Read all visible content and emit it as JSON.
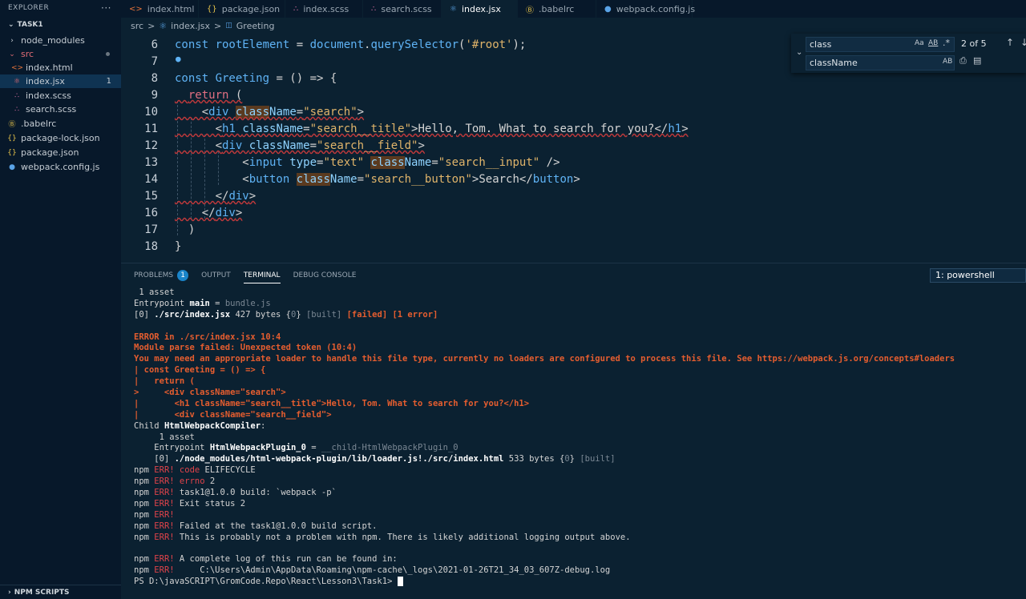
{
  "explorer": {
    "title": "EXPLORER",
    "more": "···",
    "project": "TASK1",
    "items": [
      {
        "label": "node_modules",
        "icon": "›",
        "color": "#c5ccd3"
      },
      {
        "label": "src",
        "icon": "⌄",
        "color": "#e06b74"
      },
      {
        "label": "index.html",
        "icon": "<>",
        "color": "#e7743a"
      },
      {
        "label": "index.jsx",
        "icon": "⚛",
        "color": "#e06b74",
        "badge": "1"
      },
      {
        "label": "index.scss",
        "icon": "∴",
        "color": "#d96fa3"
      },
      {
        "label": "search.scss",
        "icon": "∴",
        "color": "#d96fa3"
      },
      {
        "label": ".babelrc",
        "icon": "Ⓑ",
        "color": "#e6c34a"
      },
      {
        "label": "package-lock.json",
        "icon": "{}",
        "color": "#e6c34a"
      },
      {
        "label": "package.json",
        "icon": "{}",
        "color": "#e6c34a"
      },
      {
        "label": "webpack.config.js",
        "icon": "●",
        "color": "#5aa3e6"
      }
    ],
    "npm_scripts": "NPM SCRIPTS"
  },
  "tabs": [
    {
      "label": "index.html",
      "icon": "<>",
      "color": "#e7743a"
    },
    {
      "label": "package.json",
      "icon": "{}",
      "color": "#e6c34a"
    },
    {
      "label": "index.scss",
      "icon": "∴",
      "color": "#d96fa3"
    },
    {
      "label": "search.scss",
      "icon": "∴",
      "color": "#d96fa3"
    },
    {
      "label": "index.jsx",
      "icon": "⚛",
      "color": "#5aa3e6",
      "active": true
    },
    {
      "label": ".babelrc",
      "icon": "Ⓑ",
      "color": "#e6c34a"
    },
    {
      "label": "webpack.config.js",
      "icon": "●",
      "color": "#5aa3e6"
    }
  ],
  "breadcrumb": {
    "folder": "src",
    "sep": ">",
    "file": "index.jsx",
    "symbol": "Greeting"
  },
  "editor": {
    "line_numbers": [
      "6",
      "7",
      "8",
      "9",
      "10",
      "11",
      "12",
      "13",
      "14",
      "15",
      "16",
      "17",
      "18"
    ],
    "lines": [
      [
        [
          "const ",
          "k"
        ],
        [
          "rootElement",
          "v"
        ],
        [
          " = ",
          "p"
        ],
        [
          "document",
          "v"
        ],
        [
          ".",
          "p"
        ],
        [
          "querySelector",
          "f"
        ],
        [
          "(",
          "p"
        ],
        [
          "'#root'",
          "s"
        ],
        [
          ");",
          "p"
        ]
      ],
      [],
      [
        [
          "const ",
          "k"
        ],
        [
          "Greeting",
          "v"
        ],
        [
          " = () => {",
          "p"
        ]
      ],
      [
        [
          "  ",
          "p"
        ],
        [
          "return",
          "r"
        ],
        [
          " (",
          "p"
        ]
      ],
      [
        [
          "    <",
          "p"
        ],
        [
          "div ",
          "t"
        ],
        [
          "class",
          "a hl"
        ],
        [
          "Name",
          "a"
        ],
        [
          "=",
          "p"
        ],
        [
          "\"search\"",
          "s"
        ],
        [
          ">",
          "p"
        ]
      ],
      [
        [
          "      <",
          "p"
        ],
        [
          "h1 ",
          "t"
        ],
        [
          "className",
          "a"
        ],
        [
          "=",
          "p"
        ],
        [
          "\"search__title\"",
          "s"
        ],
        [
          ">Hello, Tom. What to search for you?</",
          "p"
        ],
        [
          "h1",
          "t"
        ],
        [
          ">",
          "p"
        ]
      ],
      [
        [
          "      <",
          "p"
        ],
        [
          "div ",
          "t"
        ],
        [
          "className",
          "a"
        ],
        [
          "=",
          "p"
        ],
        [
          "\"search__field\"",
          "s"
        ],
        [
          ">",
          "p"
        ]
      ],
      [
        [
          "          <",
          "p"
        ],
        [
          "input ",
          "t"
        ],
        [
          "type",
          "a"
        ],
        [
          "=",
          "p"
        ],
        [
          "\"text\" ",
          "s"
        ],
        [
          "class",
          "a hl"
        ],
        [
          "Name",
          "a"
        ],
        [
          "=",
          "p"
        ],
        [
          "\"search__input\"",
          "s"
        ],
        [
          " />",
          "p"
        ]
      ],
      [
        [
          "          <",
          "p"
        ],
        [
          "button ",
          "t"
        ],
        [
          "class",
          "a hl"
        ],
        [
          "Name",
          "a"
        ],
        [
          "=",
          "p"
        ],
        [
          "\"search__button\"",
          "s"
        ],
        [
          ">Search</",
          "p"
        ],
        [
          "button",
          "t"
        ],
        [
          ">",
          "p"
        ]
      ],
      [
        [
          "      </",
          "p"
        ],
        [
          "div",
          "t"
        ],
        [
          ">",
          "p"
        ]
      ],
      [
        [
          "    </",
          "p"
        ],
        [
          "div",
          "t"
        ],
        [
          ">",
          "p"
        ]
      ],
      [
        [
          "  )",
          "p"
        ]
      ],
      [
        [
          "}",
          "p"
        ]
      ]
    ]
  },
  "find": {
    "search": "class",
    "replace": "className",
    "count": "2 of 5",
    "opt_case": "Aa",
    "opt_word": "AB",
    "opt_regex": ".*",
    "opt_preserve": "AB"
  },
  "panel": {
    "tabs": [
      {
        "label": "PROBLEMS",
        "badge": "1"
      },
      {
        "label": "OUTPUT"
      },
      {
        "label": "TERMINAL",
        "active": true
      },
      {
        "label": "DEBUG CONSOLE"
      }
    ],
    "terminal_select": "1: powershell",
    "lines": [
      [
        [
          " 1 asset",
          ""
        ]
      ],
      [
        [
          "Entrypoint ",
          ""
        ],
        [
          "main",
          "tw"
        ],
        [
          " = ",
          ""
        ],
        [
          "bundle.js",
          "tg"
        ]
      ],
      [
        [
          "[0] ",
          ""
        ],
        [
          "./src/index.jsx",
          "tw"
        ],
        [
          " 427 bytes {",
          ""
        ],
        [
          "0",
          "tg"
        ],
        [
          "} ",
          ""
        ],
        [
          "[built]",
          "tg"
        ],
        [
          " ",
          ""
        ],
        [
          "[failed]",
          "te"
        ],
        [
          " ",
          ""
        ],
        [
          "[1 error]",
          "te"
        ]
      ],
      [
        [
          "",
          ""
        ]
      ],
      [
        [
          "ERROR in ./src/index.jsx 10:4",
          "te"
        ]
      ],
      [
        [
          "Module parse failed: Unexpected token (10:4)",
          "te"
        ]
      ],
      [
        [
          "You may need an appropriate loader to handle this file type, currently no loaders are configured to process this file. See https://webpack.js.org/concepts#loaders",
          "te"
        ]
      ],
      [
        [
          "| const Greeting = () => {",
          "te"
        ]
      ],
      [
        [
          "|   return (",
          "te"
        ]
      ],
      [
        [
          ">     <div className=\"search\">",
          "te"
        ]
      ],
      [
        [
          "|       <h1 className=\"search__title\">Hello, Tom. What to search for you?</h1>",
          "te"
        ]
      ],
      [
        [
          "|       <div className=\"search__field\">",
          "te"
        ]
      ],
      [
        [
          "Child ",
          ""
        ],
        [
          "HtmlWebpackCompiler",
          "tw"
        ],
        [
          ":",
          ""
        ]
      ],
      [
        [
          "     1 asset",
          ""
        ]
      ],
      [
        [
          "    Entrypoint ",
          ""
        ],
        [
          "HtmlWebpackPlugin_0",
          "tw"
        ],
        [
          " = ",
          ""
        ],
        [
          "__child-HtmlWebpackPlugin_0",
          "tg"
        ]
      ],
      [
        [
          "    [0] ",
          ""
        ],
        [
          "./node_modules/html-webpack-plugin/lib/loader.js!./src/index.html",
          "tw"
        ],
        [
          " 533 bytes {",
          ""
        ],
        [
          "0",
          "tg"
        ],
        [
          "} ",
          ""
        ],
        [
          "[built]",
          "tg"
        ]
      ],
      [
        [
          "npm ",
          ""
        ],
        [
          "ERR!",
          "tr"
        ],
        [
          " ",
          ""
        ],
        [
          "code",
          "tr"
        ],
        [
          " ELIFECYCLE",
          ""
        ]
      ],
      [
        [
          "npm ",
          ""
        ],
        [
          "ERR!",
          "tr"
        ],
        [
          " ",
          ""
        ],
        [
          "errno",
          "tr"
        ],
        [
          " 2",
          ""
        ]
      ],
      [
        [
          "npm ",
          ""
        ],
        [
          "ERR!",
          "tr"
        ],
        [
          " task1@1.0.0 build: `webpack -p`",
          ""
        ]
      ],
      [
        [
          "npm ",
          ""
        ],
        [
          "ERR!",
          "tr"
        ],
        [
          " Exit status 2",
          ""
        ]
      ],
      [
        [
          "npm ",
          ""
        ],
        [
          "ERR!",
          "tr"
        ]
      ],
      [
        [
          "npm ",
          ""
        ],
        [
          "ERR!",
          "tr"
        ],
        [
          " Failed at the task1@1.0.0 build script.",
          ""
        ]
      ],
      [
        [
          "npm ",
          ""
        ],
        [
          "ERR!",
          "tr"
        ],
        [
          " This is probably not a problem with npm. There is likely additional logging output above.",
          ""
        ]
      ],
      [
        [
          "",
          ""
        ]
      ],
      [
        [
          "npm ",
          ""
        ],
        [
          "ERR!",
          "tr"
        ],
        [
          " A complete log of this run can be found in:",
          ""
        ]
      ],
      [
        [
          "npm ",
          ""
        ],
        [
          "ERR!",
          "tr"
        ],
        [
          "     C:\\Users\\Admin\\AppData\\Roaming\\npm-cache\\_logs\\2021-01-26T21_34_03_607Z-debug.log",
          ""
        ]
      ],
      [
        [
          "PS D:\\javaSCRIPT\\GromCode.Repo\\React\\Lesson3\\Task1> ",
          ""
        ]
      ]
    ]
  }
}
